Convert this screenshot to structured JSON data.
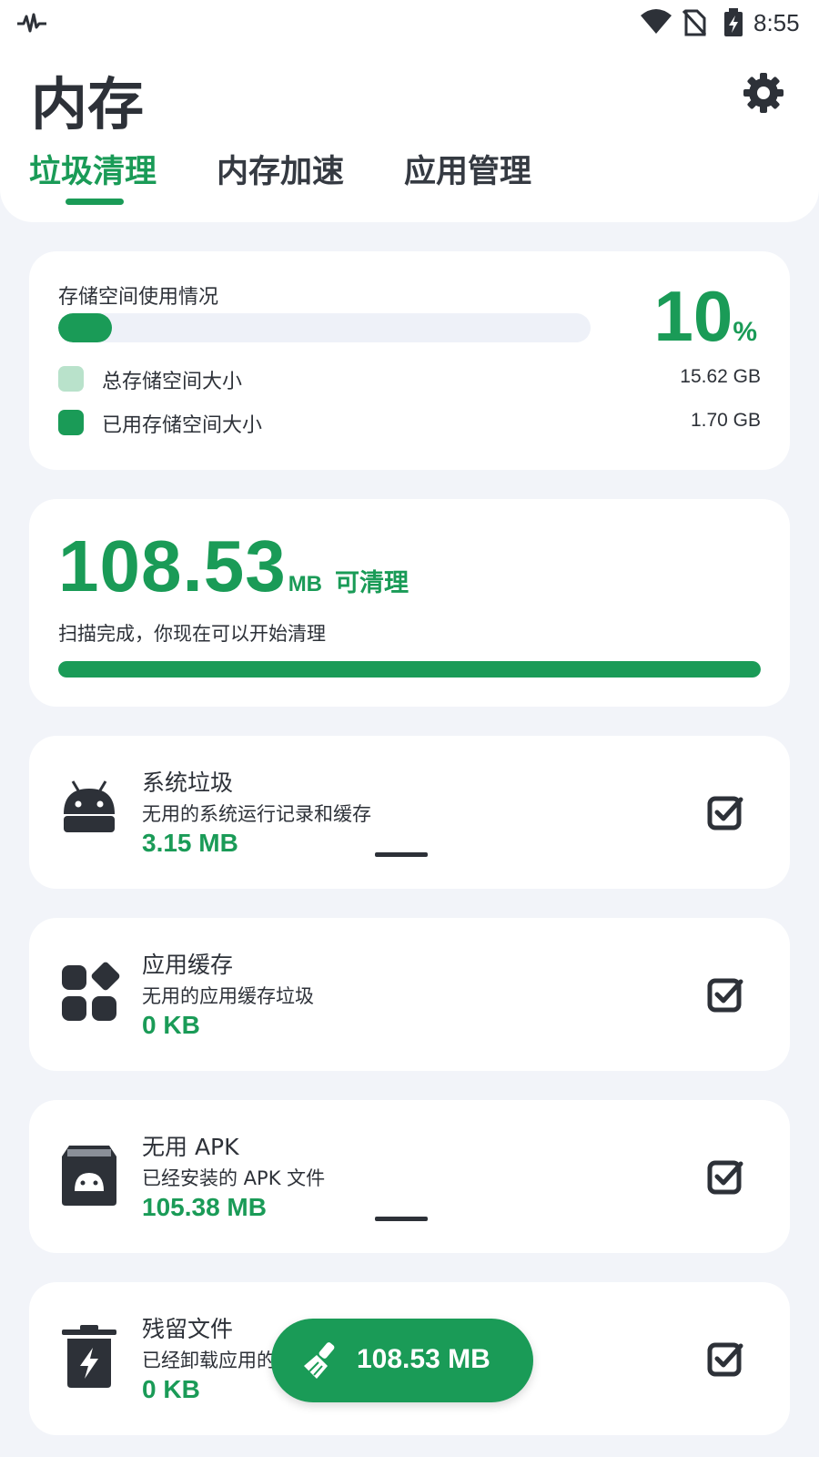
{
  "status_bar": {
    "time": "8:55"
  },
  "header": {
    "title": "内存",
    "tabs": [
      {
        "label": "垃圾清理",
        "active": true
      },
      {
        "label": "内存加速",
        "active": false
      },
      {
        "label": "应用管理",
        "active": false
      }
    ]
  },
  "storage": {
    "label": "存储空间使用情况",
    "percent": "10",
    "percent_unit": "%",
    "used_fraction": 0.1,
    "legend": [
      {
        "name": "总存储空间大小",
        "value": "15.62 GB",
        "color": "#b9e2cb"
      },
      {
        "name": "已用存储空间大小",
        "value": "1.70 GB",
        "color": "#1a9b57"
      }
    ]
  },
  "cleanable": {
    "amount": "108.53",
    "unit": "MB",
    "tag": "可清理",
    "status": "扫描完成，你现在可以开始清理",
    "progress": 1.0
  },
  "items": [
    {
      "title": "系统垃圾",
      "desc": "无用的系统运行记录和缓存",
      "size": "3.15 MB",
      "icon": "android-icon",
      "checked": true
    },
    {
      "title": "应用缓存",
      "desc": "无用的应用缓存垃圾",
      "size": "0 KB",
      "icon": "apps-grid-icon",
      "checked": true
    },
    {
      "title": "无用 APK",
      "desc": "已经安装的 APK 文件",
      "size": "105.38 MB",
      "icon": "apk-box-icon",
      "checked": true
    },
    {
      "title": "残留文件",
      "desc": "已经卸载应用的",
      "size": "0 KB",
      "icon": "trash-bolt-icon",
      "checked": true
    }
  ],
  "clean_button": {
    "label": "108.53 MB",
    "icon": "broom-icon"
  },
  "colors": {
    "accent": "#1a9b57",
    "background": "#f2f4f9",
    "text": "#2d3138"
  }
}
